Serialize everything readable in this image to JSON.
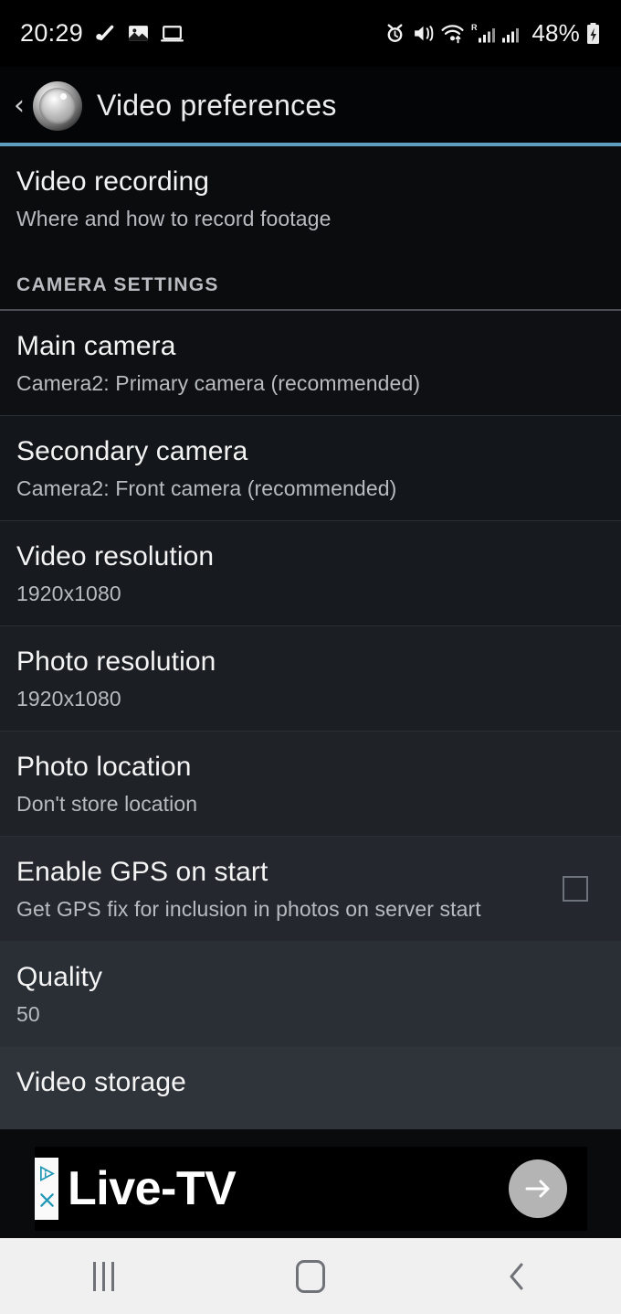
{
  "status_bar": {
    "clock": "20:29",
    "battery_percent": "48%",
    "left_icons": [
      "check-slash-icon",
      "image-icon",
      "laptop-icon"
    ],
    "right_icons": [
      "alarm-icon",
      "mute-vibrate-icon",
      "wifi-transfer-icon",
      "roaming-signal-icon",
      "signal-bars-icon",
      "battery-charging-icon"
    ]
  },
  "app_bar": {
    "back_icon": "‹",
    "app_icon": "camera-lens-icon",
    "title": "Video preferences",
    "accent_color": "#5f9ec0"
  },
  "intro": {
    "title": "Video recording",
    "subtitle": "Where and how to record footage"
  },
  "section_header": "CAMERA SETTINGS",
  "settings": [
    {
      "title": "Main camera",
      "subtitle": "Camera2: Primary camera (recommended)",
      "control": "none"
    },
    {
      "title": "Secondary camera",
      "subtitle": "Camera2: Front camera (recommended)",
      "control": "none"
    },
    {
      "title": "Video resolution",
      "subtitle": "1920x1080",
      "control": "none"
    },
    {
      "title": "Photo resolution",
      "subtitle": "1920x1080",
      "control": "none"
    },
    {
      "title": "Photo location",
      "subtitle": "Don't store location",
      "control": "none"
    },
    {
      "title": "Enable GPS on start",
      "subtitle": "Get GPS fix for inclusion in photos on server start",
      "control": "checkbox",
      "checked": false
    },
    {
      "title": "Quality",
      "subtitle": "50",
      "control": "none"
    }
  ],
  "ad": {
    "text": "Live-TV",
    "adchoices_icon": "adchoices-triangle-icon",
    "close_icon": "close-x-icon",
    "cta_icon": "arrow-right-icon",
    "cta_color": "#b4b4b4"
  },
  "nav_bar": {
    "recents_label": "|||",
    "home_label": "home-square-icon",
    "back_label": "‹"
  }
}
